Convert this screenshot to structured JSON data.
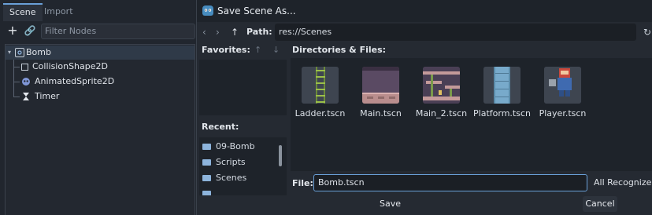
{
  "editor": {
    "tabs": [
      {
        "label": "Scene"
      },
      {
        "label": "Import"
      }
    ],
    "filter": {
      "placeholder": "Filter Nodes"
    },
    "tree": {
      "root": {
        "label": "Bomb",
        "icon": "node2d-icon"
      },
      "children": [
        {
          "label": "CollisionShape2D",
          "icon": "collision-shape-icon"
        },
        {
          "label": "AnimatedSprite2D",
          "icon": "animated-sprite-icon"
        },
        {
          "label": "Timer",
          "icon": "timer-icon"
        }
      ]
    }
  },
  "dialog": {
    "title": "Save Scene As...",
    "path_label": "Path:",
    "path_value": "res://Scenes",
    "favorites_label": "Favorites:",
    "recent_label": "Recent:",
    "recent_items": [
      {
        "label": "09-Bomb"
      },
      {
        "label": "Scripts"
      },
      {
        "label": "Scenes"
      }
    ],
    "directories_label": "Directories & Files:",
    "files": [
      {
        "name": "Ladder.tscn"
      },
      {
        "name": "Main.tscn"
      },
      {
        "name": "Main_2.tscn"
      },
      {
        "name": "Platform.tscn"
      },
      {
        "name": "Player.tscn"
      }
    ],
    "file_label": "File:",
    "file_value": "Bomb.tscn",
    "filter_value": "All Recognized (",
    "save_label": "Save",
    "cancel_label": "Cancel"
  },
  "colors": {
    "accent": "#6aa0d8",
    "background": "#1d2229",
    "godot_blue": "#478cbf"
  }
}
